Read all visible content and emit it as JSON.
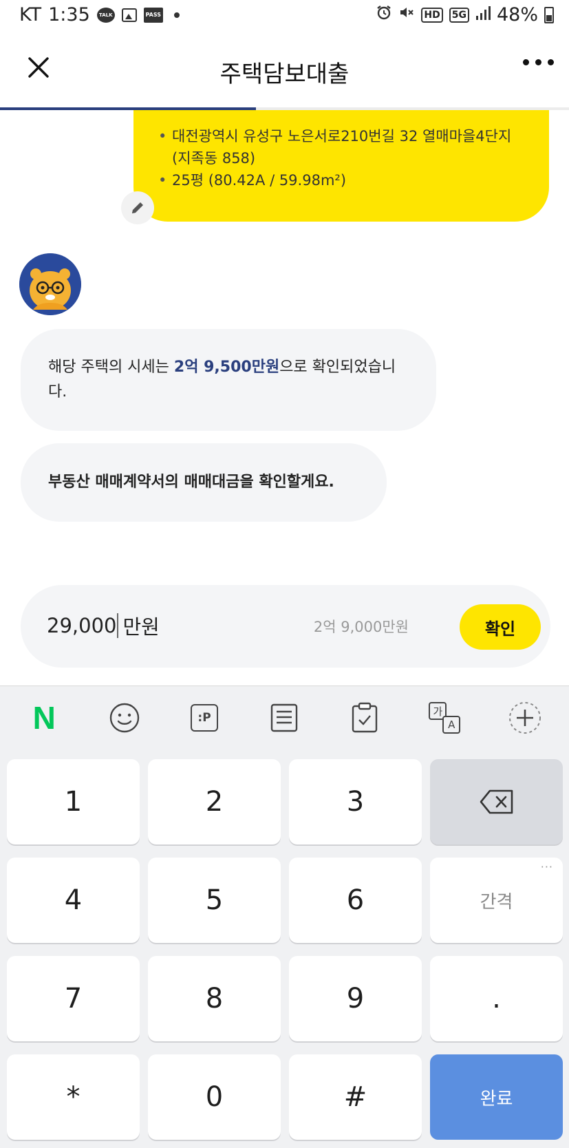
{
  "status_bar": {
    "carrier": "KT",
    "time": "1:35",
    "talk_badge": "TALK",
    "pass_badge": "PASS",
    "hd_badge": "HD",
    "network_badge": "5G",
    "battery": "48%"
  },
  "header": {
    "title": "주택담보대출",
    "progress_percent": 45
  },
  "chat": {
    "user_bubble": {
      "items": [
        "대전광역시 유성구 노은서로210번길 32 열매마을4단지 (지족동 858)",
        "25평 (80.42A / 59.98m²)"
      ]
    },
    "bot_message_1": {
      "prefix": "해당 주택의 시세는 ",
      "highlight": "2억 9,500만원",
      "suffix": "으로 확인되었습니다."
    },
    "bot_message_2": "부동산 매매계약서의 매매대금을 확인할게요."
  },
  "amount_input": {
    "value": "29,000",
    "unit": "만원",
    "hint": "2억 9,000만원",
    "confirm_label": "확인"
  },
  "keyboard": {
    "toolbar": [
      "naver-icon",
      "emoji-icon",
      "parking-icon",
      "notes-icon",
      "clipboard-icon",
      "translate-icon",
      "add-icon"
    ],
    "naver_label": "N",
    "translate_ko": "가",
    "translate_en": "A",
    "parking_label": ":P",
    "keys": {
      "k1": "1",
      "k2": "2",
      "k3": "3",
      "k4": "4",
      "k5": "5",
      "k6": "6",
      "k7": "7",
      "k8": "8",
      "k9": "9",
      "dot": ".",
      "star": "*",
      "k0": "0",
      "hash": "#",
      "space": "간격",
      "done": "완료"
    }
  },
  "colors": {
    "accent_yellow": "#fee500",
    "highlight_navy": "#2a3f7e",
    "done_blue": "#5b8fe0",
    "naver_green": "#03c75a"
  }
}
